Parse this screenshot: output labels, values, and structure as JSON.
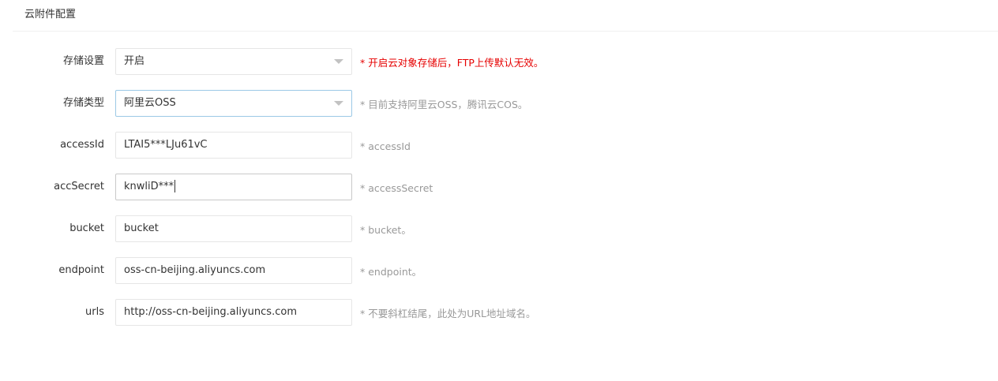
{
  "header": {
    "title": "云附件配置"
  },
  "form": {
    "storage_setting": {
      "label": "存储设置",
      "value": "开启",
      "hint": "* 开启云对象存储后，FTP上传默认无效。"
    },
    "storage_type": {
      "label": "存储类型",
      "value": "阿里云OSS",
      "hint": "* 目前支持阿里云OSS，腾讯云COS。"
    },
    "access_id": {
      "label": "accessId",
      "value": "LTAI5***LJu61vC",
      "hint": "* accessId"
    },
    "acc_secret": {
      "label": "accSecret",
      "value": "knwliD***",
      "hint": "* accessSecret"
    },
    "bucket": {
      "label": "bucket",
      "value": "bucket",
      "hint": "* bucket。"
    },
    "endpoint": {
      "label": "endpoint",
      "value": "oss-cn-beijing.aliyuncs.com",
      "hint": "* endpoint。"
    },
    "urls": {
      "label": "urls",
      "value": "http://oss-cn-beijing.aliyuncs.com",
      "hint": "* 不要斜杠结尾，此处为URL地址域名。"
    }
  },
  "icons": {
    "select_arrow": "chevron-down-icon"
  },
  "colors": {
    "warning_hint": "#e60000",
    "hint": "#999999",
    "focused_border": "#9cc9e6"
  }
}
